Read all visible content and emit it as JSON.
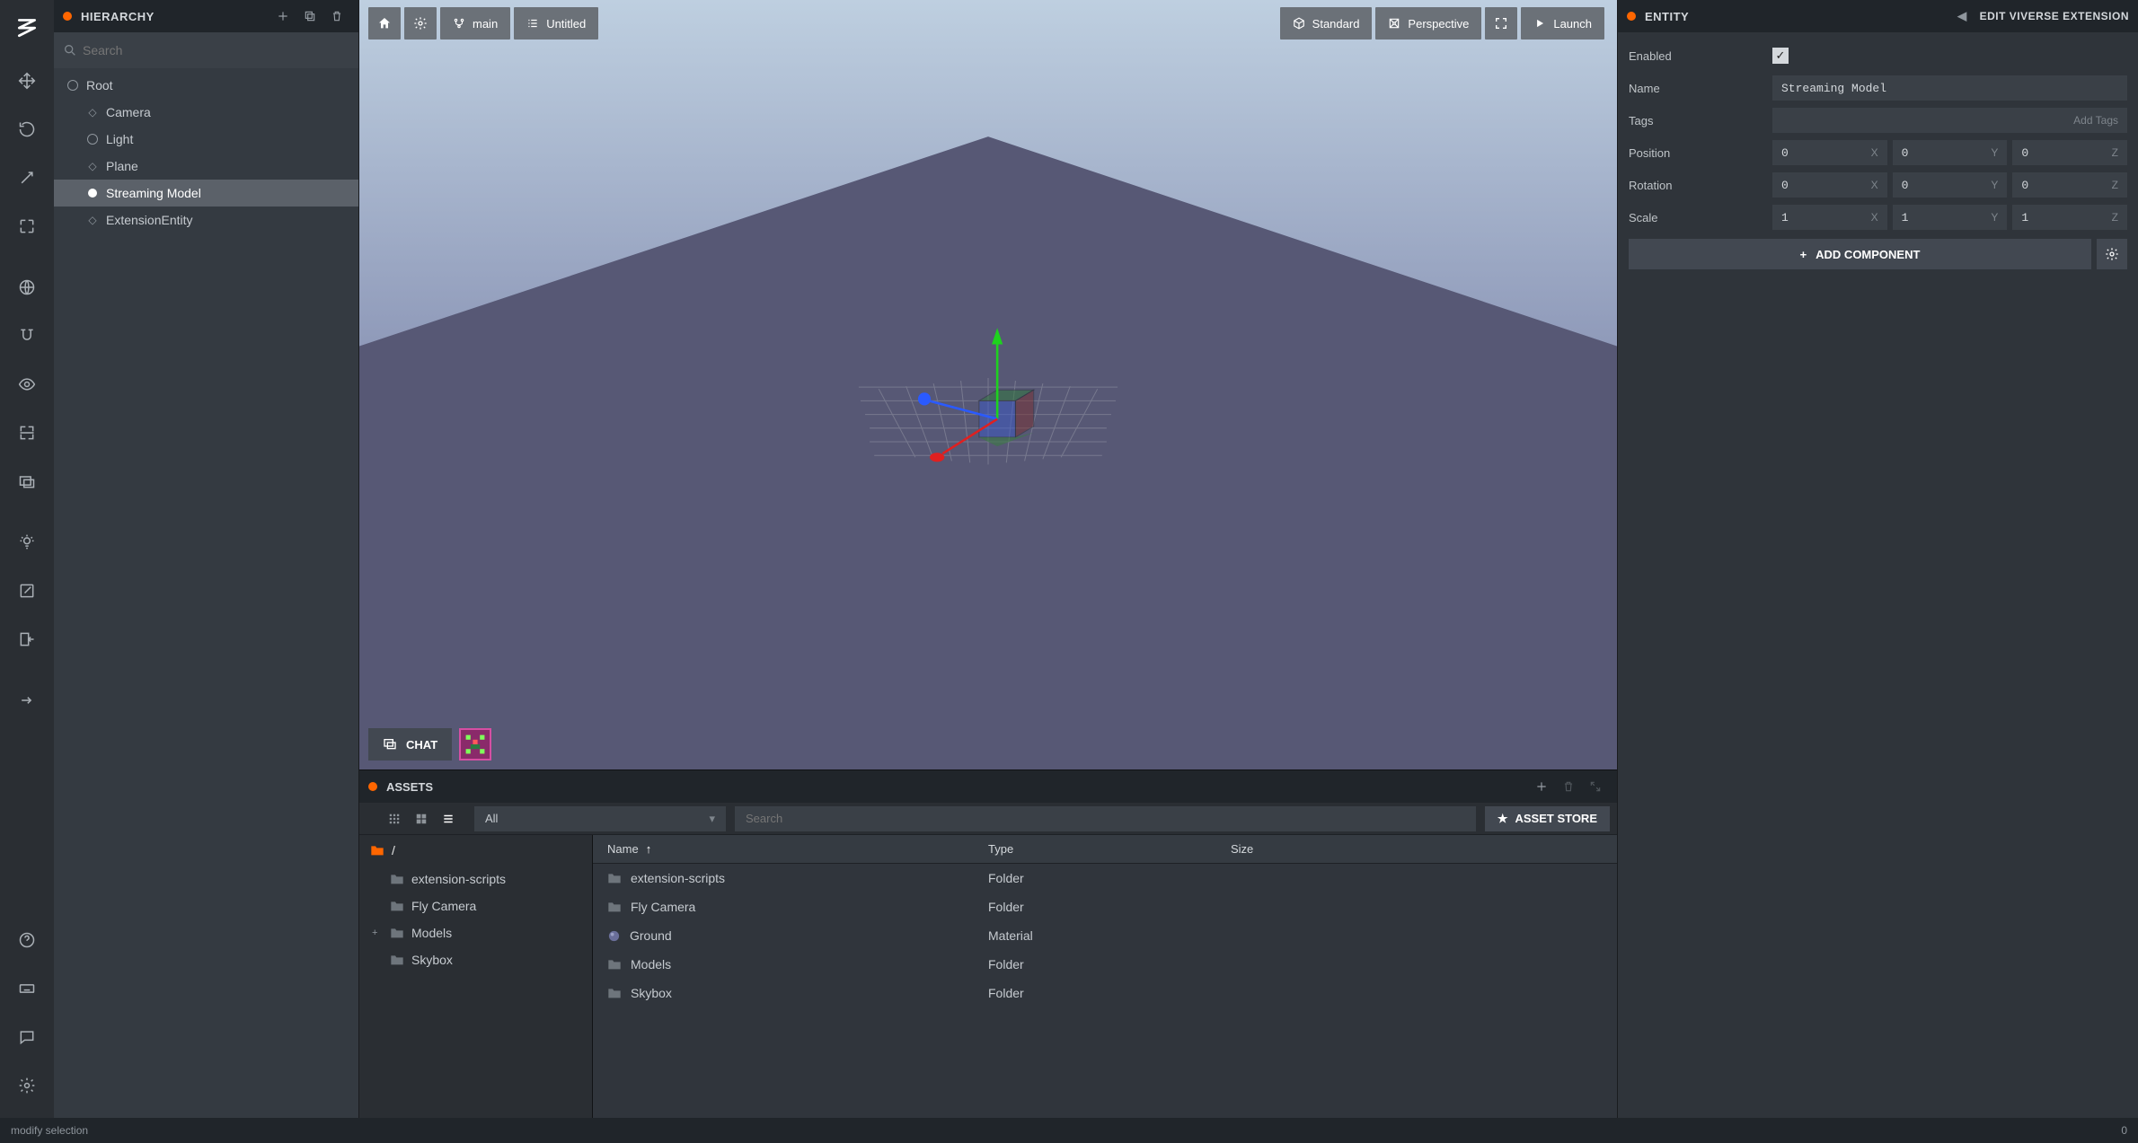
{
  "hierarchy": {
    "title": "HIERARCHY",
    "search_placeholder": "Search",
    "items": [
      {
        "label": "Root",
        "depth": 0,
        "bullet": "hollow"
      },
      {
        "label": "Camera",
        "depth": 1,
        "bullet": "diamond"
      },
      {
        "label": "Light",
        "depth": 1,
        "bullet": "hollow"
      },
      {
        "label": "Plane",
        "depth": 1,
        "bullet": "diamond"
      },
      {
        "label": "Streaming Model",
        "depth": 1,
        "bullet": "dot",
        "selected": true
      },
      {
        "label": "ExtensionEntity",
        "depth": 1,
        "bullet": "diamond"
      }
    ]
  },
  "viewport": {
    "branch": "main",
    "scene": "Untitled",
    "shading": "Standard",
    "projection": "Perspective",
    "launch": "Launch",
    "chat": "CHAT"
  },
  "assets": {
    "title": "ASSETS",
    "filter": "All",
    "search_placeholder": "Search",
    "store": "ASSET STORE",
    "crumb": "/",
    "tree": [
      {
        "label": "extension-scripts"
      },
      {
        "label": "Fly Camera"
      },
      {
        "label": "Models",
        "expandable": true
      },
      {
        "label": "Skybox"
      }
    ],
    "cols": {
      "name": "Name",
      "type": "Type",
      "size": "Size"
    },
    "rows": [
      {
        "name": "extension-scripts",
        "type": "Folder",
        "icon": "folder"
      },
      {
        "name": "Fly Camera",
        "type": "Folder",
        "icon": "folder"
      },
      {
        "name": "Ground",
        "type": "Material",
        "icon": "material"
      },
      {
        "name": "Models",
        "type": "Folder",
        "icon": "folder"
      },
      {
        "name": "Skybox",
        "type": "Folder",
        "icon": "folder"
      }
    ]
  },
  "entity": {
    "title": "ENTITY",
    "ext": "EDIT VIVERSE EXTENSION",
    "enabled_label": "Enabled",
    "enabled": true,
    "name_label": "Name",
    "name": "Streaming Model",
    "tags_label": "Tags",
    "tags_placeholder": "Add Tags",
    "position_label": "Position",
    "position": {
      "x": "0",
      "y": "0",
      "z": "0"
    },
    "rotation_label": "Rotation",
    "rotation": {
      "x": "0",
      "y": "0",
      "z": "0"
    },
    "scale_label": "Scale",
    "scale": {
      "x": "1",
      "y": "1",
      "z": "1"
    },
    "add_component": "ADD COMPONENT"
  },
  "status": {
    "left": "modify selection",
    "right": "0"
  }
}
